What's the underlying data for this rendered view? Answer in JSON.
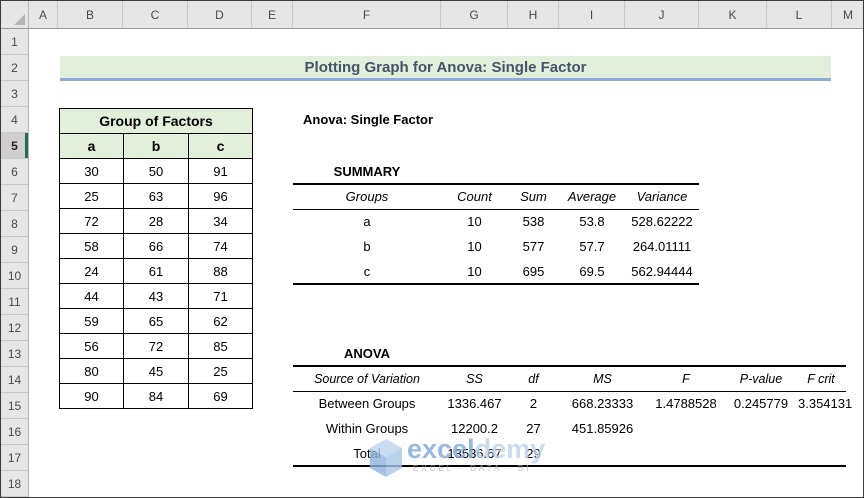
{
  "banner": {
    "title": "Plotting Graph for Anova: Single Factor"
  },
  "grid": {
    "columns": [
      {
        "letter": "A",
        "width": 29
      },
      {
        "letter": "B",
        "width": 65
      },
      {
        "letter": "C",
        "width": 65
      },
      {
        "letter": "D",
        "width": 64
      },
      {
        "letter": "E",
        "width": 41
      },
      {
        "letter": "F",
        "width": 148
      },
      {
        "letter": "G",
        "width": 67
      },
      {
        "letter": "H",
        "width": 51
      },
      {
        "letter": "I",
        "width": 66
      },
      {
        "letter": "J",
        "width": 74
      },
      {
        "letter": "K",
        "width": 68
      },
      {
        "letter": "L",
        "width": 65
      },
      {
        "letter": "M",
        "width": 33
      }
    ],
    "rows": [
      "1",
      "2",
      "3",
      "4",
      "5",
      "6",
      "7",
      "8",
      "9",
      "10",
      "11",
      "12",
      "13",
      "14",
      "15",
      "16",
      "17",
      "18"
    ],
    "selected_row": "5"
  },
  "group_table": {
    "title": "Group of Factors",
    "headers": [
      "a",
      "b",
      "c"
    ],
    "rows": [
      [
        "30",
        "50",
        "91"
      ],
      [
        "25",
        "63",
        "96"
      ],
      [
        "72",
        "28",
        "34"
      ],
      [
        "58",
        "66",
        "74"
      ],
      [
        "24",
        "61",
        "88"
      ],
      [
        "44",
        "43",
        "71"
      ],
      [
        "59",
        "65",
        "62"
      ],
      [
        "56",
        "72",
        "85"
      ],
      [
        "80",
        "45",
        "25"
      ],
      [
        "90",
        "84",
        "69"
      ]
    ]
  },
  "anova_output": {
    "heading": "Anova: Single Factor",
    "summary": {
      "label": "SUMMARY",
      "headers": [
        "Groups",
        "Count",
        "Sum",
        "Average",
        "Variance"
      ],
      "rows": [
        [
          "a",
          "10",
          "538",
          "53.8",
          "528.62222"
        ],
        [
          "b",
          "10",
          "577",
          "57.7",
          "264.01111"
        ],
        [
          "c",
          "10",
          "695",
          "69.5",
          "562.94444"
        ]
      ]
    },
    "anova": {
      "label": "ANOVA",
      "headers": [
        "Source of Variation",
        "SS",
        "df",
        "MS",
        "F",
        "P-value",
        "F crit"
      ],
      "rows": [
        [
          "Between Groups",
          "1336.467",
          "2",
          "668.23333",
          "1.4788528",
          "0.245779",
          "3.354131"
        ],
        [
          "Within Groups",
          "12200.2",
          "27",
          "451.85926",
          "",
          "",
          ""
        ],
        [
          "Total",
          "13536.67",
          "29",
          "",
          "",
          "",
          ""
        ]
      ]
    }
  },
  "watermark": {
    "brand_part1": "excel",
    "brand_part2": "demy",
    "tagline": "EXCEL · DATA · BI"
  },
  "colors": {
    "banner_bg": "#E2EFDA",
    "banner_text": "#44546A",
    "banner_underline": "#8EAADB",
    "table_header_bg": "#E2EFDA",
    "selected_row_bg": "#D0CECE",
    "selected_row_accent": "#1E7145",
    "header_bg": "#E6E6E6",
    "watermark_blue": "#7FA8D9"
  }
}
